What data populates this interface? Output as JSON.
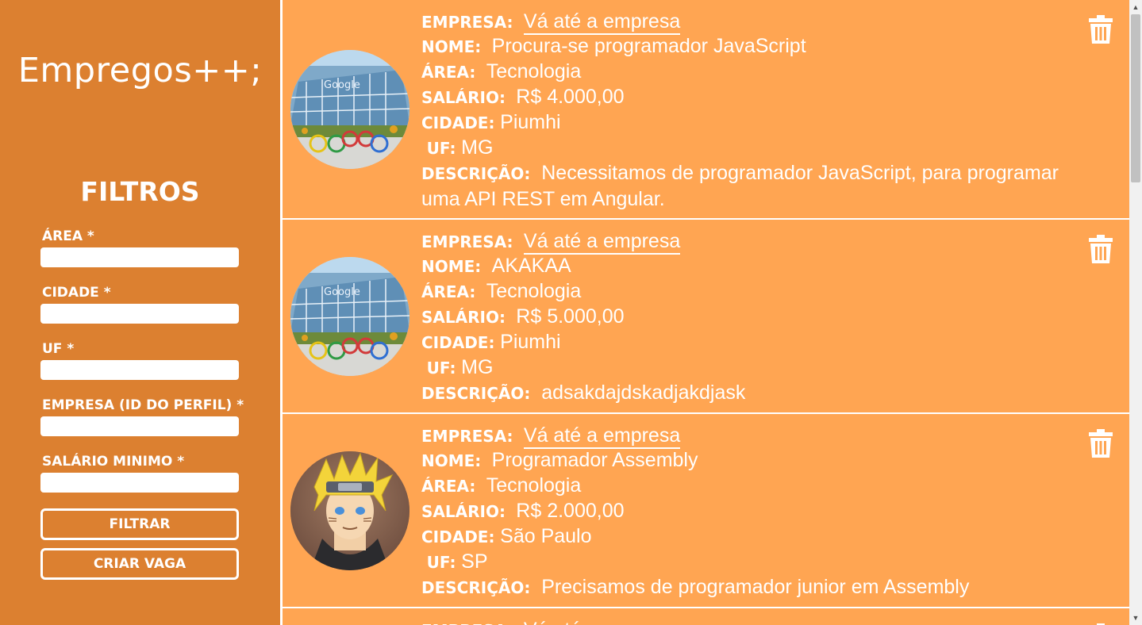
{
  "app": {
    "logo": "Empregos++;"
  },
  "filters": {
    "title": "FILTROS",
    "fields": [
      {
        "label": "ÁREA *",
        "value": ""
      },
      {
        "label": "CIDADE *",
        "value": ""
      },
      {
        "label": "UF *",
        "value": ""
      },
      {
        "label": "EMPRESA (ID DO PERFIL) *",
        "value": ""
      },
      {
        "label": "SALÁRIO MINIMO *",
        "value": ""
      }
    ],
    "filter_button": "FILTRAR",
    "create_button": "CRIAR VAGA"
  },
  "labels": {
    "empresa": "EMPRESA:",
    "nome": "NOME:",
    "area": "ÁREA:",
    "salario": "SALÁRIO:",
    "cidade": "CIDADE:",
    "uf": "UF:",
    "descricao": "DESCRIÇÃO:"
  },
  "jobs": [
    {
      "company_link": "Vá até a empresa",
      "nome": "Procura-se programador JavaScript",
      "area": "Tecnologia",
      "salario": "R$ 4.000,00",
      "cidade": "Piumhi",
      "uf": "MG",
      "descricao_line1": "Necessitamos de programador JavaScript, para programar",
      "descricao_line2": "uma API REST em Angular.",
      "avatar": "google-office-photo"
    },
    {
      "company_link": "Vá até a empresa",
      "nome": "AKAKAA",
      "area": "Tecnologia",
      "salario": "R$ 5.000,00",
      "cidade": "Piumhi",
      "uf": "MG",
      "descricao_line1": "adsakdajdskadjakdjask",
      "avatar": "google-office-photo"
    },
    {
      "company_link": "Vá até a empresa",
      "nome": "Programador Assembly",
      "area": "Tecnologia",
      "salario": "R$ 2.000,00",
      "cidade": "São Paulo",
      "uf": "SP",
      "descricao_line1": "Precisamos de programador junior em Assembly",
      "avatar": "anime-character-portrait"
    },
    {
      "company_link": "Vá até a empresa"
    }
  ],
  "colors": {
    "sidebar": "#dc8030",
    "card": "#ffa552",
    "text": "#ffffff"
  }
}
